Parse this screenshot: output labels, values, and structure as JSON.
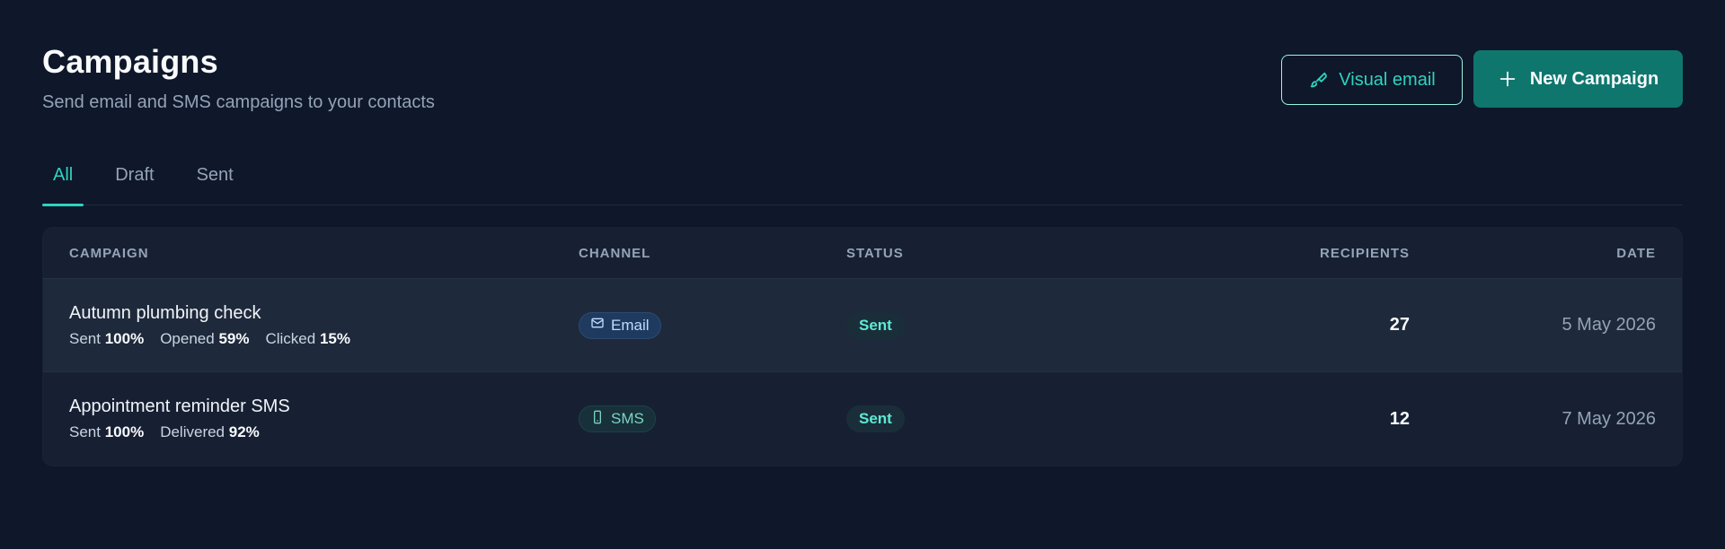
{
  "header": {
    "title": "Campaigns",
    "subtitle": "Send email and SMS campaigns to your contacts",
    "visual_email_label": "Visual email",
    "new_campaign_label": "New Campaign",
    "icons": {
      "visual_email": "brush-icon",
      "new_campaign": "plus-icon"
    }
  },
  "tabs": [
    {
      "label": "All",
      "active": true
    },
    {
      "label": "Draft",
      "active": false
    },
    {
      "label": "Sent",
      "active": false
    }
  ],
  "table": {
    "columns": [
      "CAMPAIGN",
      "CHANNEL",
      "STATUS",
      "RECIPIENTS",
      "DATE"
    ],
    "rows": [
      {
        "name": "Autumn plumbing check",
        "metrics": [
          {
            "label": "Sent",
            "value": "100%"
          },
          {
            "label": "Opened",
            "value": "59%"
          },
          {
            "label": "Clicked",
            "value": "15%"
          }
        ],
        "channel": "Email",
        "channel_icon": "mail-icon",
        "status": "Sent",
        "recipients": "27",
        "date": "5 May 2026"
      },
      {
        "name": "Appointment reminder SMS",
        "metrics": [
          {
            "label": "Sent",
            "value": "100%"
          },
          {
            "label": "Delivered",
            "value": "92%"
          }
        ],
        "channel": "SMS",
        "channel_icon": "phone-icon",
        "status": "Sent",
        "recipients": "12",
        "date": "7 May 2026"
      }
    ]
  },
  "colors": {
    "background": "#0f172a",
    "accent": "#2dd4bf",
    "primary_button": "#0f766e"
  }
}
